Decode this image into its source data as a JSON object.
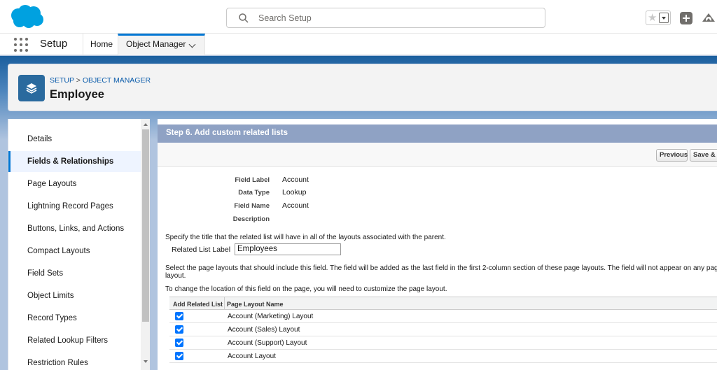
{
  "header": {
    "search_placeholder": "Search Setup"
  },
  "nav": {
    "app_name": "Setup",
    "tabs": [
      {
        "label": "Home"
      },
      {
        "label": "Object Manager"
      }
    ]
  },
  "page_header": {
    "breadcrumb": [
      "SETUP",
      "OBJECT MANAGER"
    ],
    "breadcrumb_separator": ">",
    "title": "Employee"
  },
  "sidebar": {
    "active": "Fields & Relationships",
    "items": [
      {
        "label": "Details"
      },
      {
        "label": "Fields & Relationships"
      },
      {
        "label": "Page Layouts"
      },
      {
        "label": "Lightning Record Pages"
      },
      {
        "label": "Buttons, Links, and Actions"
      },
      {
        "label": "Compact Layouts"
      },
      {
        "label": "Field Sets"
      },
      {
        "label": "Object Limits"
      },
      {
        "label": "Record Types"
      },
      {
        "label": "Related Lookup Filters"
      },
      {
        "label": "Restriction Rules"
      }
    ]
  },
  "main": {
    "step_title": "Step 6. Add custom related lists",
    "buttons": {
      "previous": "Previous",
      "save": "Save & N"
    },
    "fields": [
      {
        "label": "Field Label",
        "value": "Account"
      },
      {
        "label": "Data Type",
        "value": "Lookup"
      },
      {
        "label": "Field Name",
        "value": "Account"
      },
      {
        "label": "Description",
        "value": ""
      }
    ],
    "title_instruction": "Specify the title that the related list will have in all of the layouts associated with the parent.",
    "related_list_label": "Related List Label",
    "related_list_value": "Employees",
    "layouts_instruction_1": "Select the page layouts that should include this field. The field will be added as the last field in the first 2-column section of these page layouts. The field will not appear on any pages if y",
    "layouts_instruction_2": "layout.",
    "location_instruction": "To change the location of this field on the page, you will need to customize the page layout.",
    "table": {
      "headers": [
        "Add Related List",
        "Page Layout Name"
      ],
      "rows": [
        {
          "checked": true,
          "name": "Account (Marketing) Layout"
        },
        {
          "checked": true,
          "name": "Account (Sales) Layout"
        },
        {
          "checked": true,
          "name": "Account (Support) Layout"
        },
        {
          "checked": true,
          "name": "Account Layout"
        }
      ]
    }
  },
  "colors": {
    "brand_blue": "#0176d3",
    "step_bar": "#8fa2c4",
    "checkbox": "#0075ff"
  }
}
